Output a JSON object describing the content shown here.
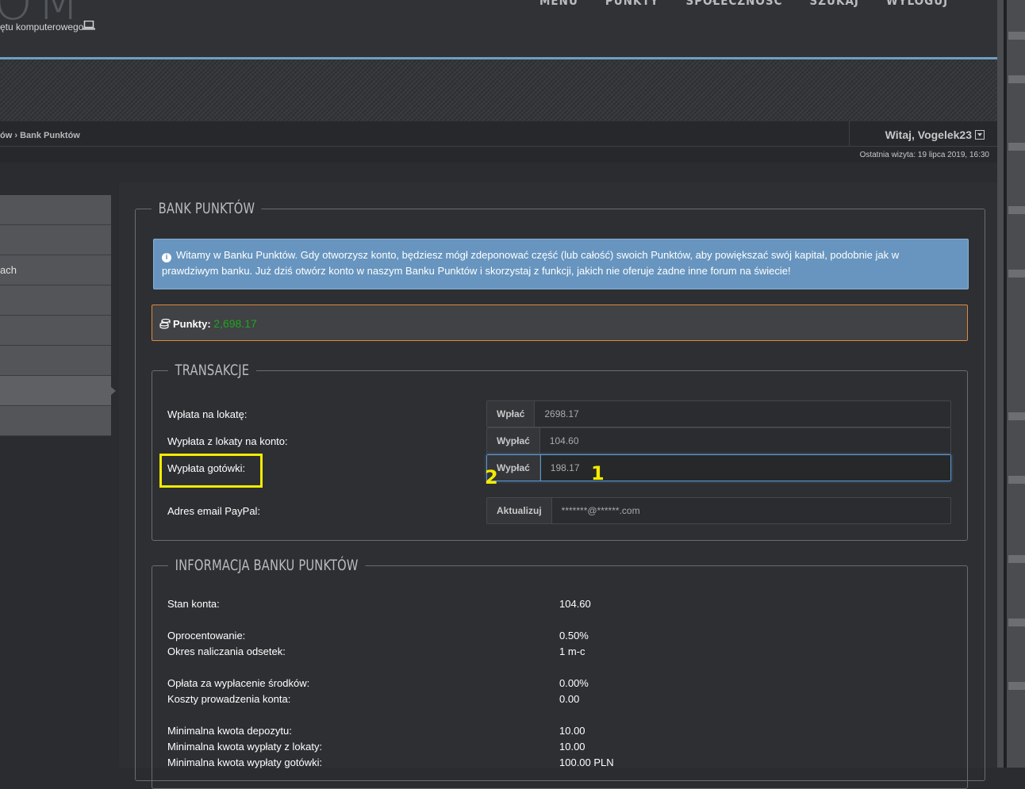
{
  "header": {
    "logo_text": "OM",
    "tagline": "ętu komputerowego",
    "nav": [
      "MENU",
      "PUNKTY",
      "SPOŁECZNOŚĆ",
      "SZUKAJ",
      "WYLOGUJ"
    ]
  },
  "subbar": {
    "breadcrumb_prev": "ów",
    "breadcrumb_current": "Bank Punktów",
    "welcome": "Witaj, Vogelek23",
    "last_visit": "Ostatnia wizyta: 19 lipca 2019, 16:30"
  },
  "sidebar": {
    "items": [
      "",
      "",
      "ach",
      "",
      "",
      "",
      "",
      ""
    ]
  },
  "bank": {
    "title": "BANK PUNKTÓW",
    "info_text": "Witamy w Banku Punktów. Gdy otworzysz konto, będziesz mógł zdeponować część (lub całość) swoich Punktów, aby powiększać swój kapitał, podobnie jak w prawdziwym banku. Już dziś otwórz konto w naszym Banku Punktów i skorzystaj z funkcji, jakich nie oferuje żadne inne forum na świecie!",
    "points_label": "Punkty:",
    "points_value": "2,698.17"
  },
  "transactions": {
    "title": "TRANSAKCJE",
    "rows": [
      {
        "label": "Wpłata na lokatę:",
        "button": "Wpłać",
        "value": "2698.17"
      },
      {
        "label": "Wypłata z lokaty na konto:",
        "button": "Wypłać",
        "value": "104.60"
      },
      {
        "label": "Wypłata gotówki:",
        "button": "Wypłać",
        "value": "198.17"
      },
      {
        "label": "Adres email PayPal:",
        "button": "Aktualizuj",
        "value": "*******@******.com"
      }
    ]
  },
  "annotations": {
    "one": "1",
    "two": "2",
    "color": "#f4ec00"
  },
  "info": {
    "title": "INFORMACJA BANKU PUNKTÓW",
    "rows": [
      {
        "label": "Stan konta:",
        "value": "104.60"
      },
      {
        "label": "Oprocentowanie:",
        "value": "0.50%"
      },
      {
        "label": "Okres naliczania odsetek:",
        "value": "1 m-c"
      },
      {
        "label": "Opłata za wypłacenie środków:",
        "value": "0.00%"
      },
      {
        "label": "Koszty prowadzenia konta:",
        "value": "0.00"
      },
      {
        "label": "Minimalna kwota depozytu:",
        "value": "10.00"
      },
      {
        "label": "Minimalna kwota wypłaty z lokaty:",
        "value": "10.00"
      },
      {
        "label": "Minimalna kwota wypłaty gotówki:",
        "value": "100.00 PLN"
      }
    ]
  },
  "colors": {
    "accent_blue": "#6e9ec2",
    "points_green": "#1fa51f",
    "points_border": "#e08a3a",
    "info_bg": "#6795bf"
  }
}
